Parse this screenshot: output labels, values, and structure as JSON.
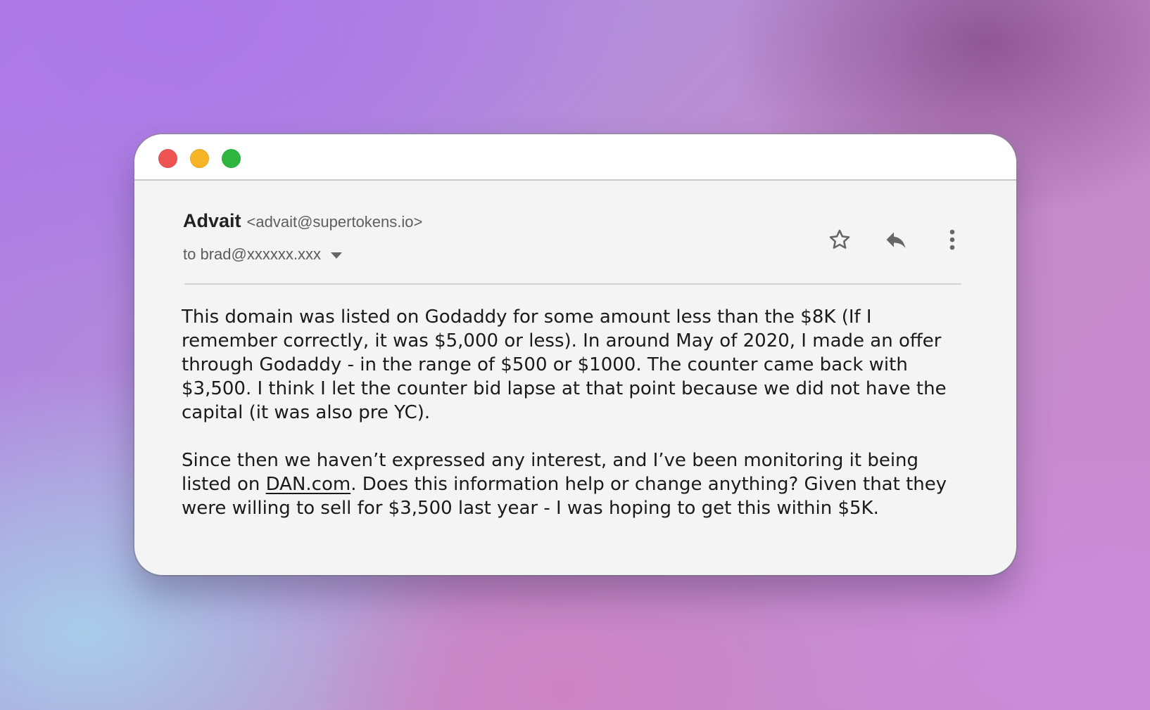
{
  "window": {
    "controls": [
      "close",
      "minimize",
      "maximize"
    ],
    "colors": {
      "close": "#f05452",
      "minimize": "#f6b526",
      "maximize": "#2db741"
    }
  },
  "email": {
    "sender_name": "Advait",
    "sender_email": "<advait@supertokens.io>",
    "recipient": "to brad@xxxxxx.xxx",
    "actions": [
      "star-icon",
      "reply-icon",
      "more-vertical-icon"
    ],
    "paragraph1": "This domain was listed on Godaddy for some amount less than the $8K (If I remember correctly, it was $5,000 or less). In around May of 2020, I made an offer through Godaddy - in the range of $500 or $1000. The counter came back with $3,500. I think I let the counter bid lapse at that point because we did not have the capital (it was also pre YC).",
    "paragraph2_before": "Since then we haven’t expressed any interest, and I’ve been monitoring it being listed on ",
    "paragraph2_link": "DAN.com",
    "paragraph2_after": ". Does this information help or change anything? Given that they were willing to sell for $3,500 last year - I was hoping to get this within $5K."
  }
}
